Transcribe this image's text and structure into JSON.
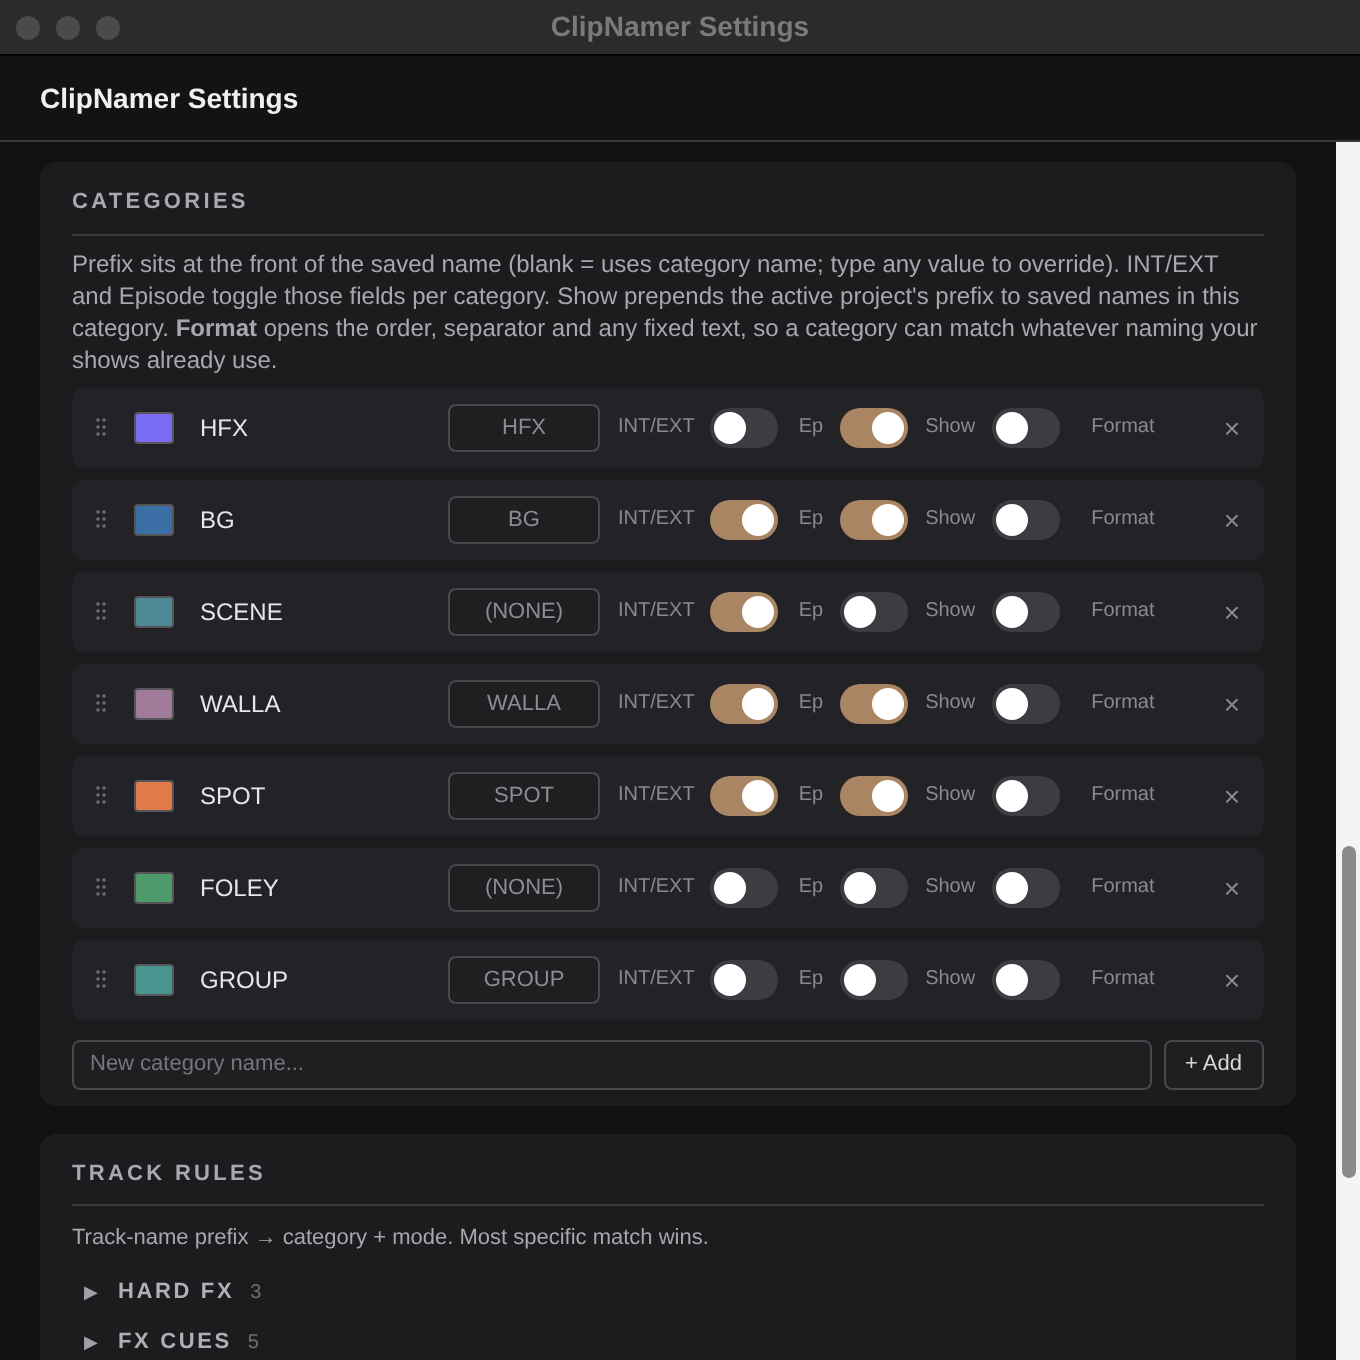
{
  "window": {
    "title": "ClipNamer Settings"
  },
  "header": {
    "title": "ClipNamer Settings"
  },
  "categories": {
    "heading": "CATEGORIES",
    "description": "Prefix sits at the front of the saved name (blank = uses category name; type any value to override). INT/EXT and Episode toggle those fields per category. Show prepends the active project's prefix to saved names in this category. **Format** opens the order, separator and any fixed text, so a category can match whatever naming your shows already use.",
    "items": [
      {
        "name": "HFX",
        "color": "#7b6cf6",
        "prefix": "HFX",
        "toggles": [
          {
            "label": "INT/EXT",
            "on": false
          },
          {
            "label": "Ep",
            "on": true
          },
          {
            "label": "Show",
            "on": false
          }
        ],
        "format": "Format",
        "remove": "×"
      },
      {
        "name": "BG",
        "color": "#3a6ea5",
        "prefix": "BG",
        "toggles": [
          {
            "label": "INT/EXT",
            "on": true
          },
          {
            "label": "Ep",
            "on": true
          },
          {
            "label": "Show",
            "on": false
          }
        ],
        "format": "Format",
        "remove": "×"
      },
      {
        "name": "SCENE",
        "color": "#4e8a96",
        "placeholder": "(NONE)",
        "toggles": [
          {
            "label": "INT/EXT",
            "on": true
          },
          {
            "label": "Ep",
            "on": false
          },
          {
            "label": "Show",
            "on": false
          }
        ],
        "format": "Format",
        "remove": "×"
      },
      {
        "name": "WALLA",
        "color": "#a07c9a",
        "prefix": "WALLA",
        "toggles": [
          {
            "label": "INT/EXT",
            "on": true
          },
          {
            "label": "Ep",
            "on": true
          },
          {
            "label": "Show",
            "on": false
          }
        ],
        "format": "Format",
        "remove": "×"
      },
      {
        "name": "SPOT",
        "color": "#e07a4a",
        "prefix": "SPOT",
        "toggles": [
          {
            "label": "INT/EXT",
            "on": true
          },
          {
            "label": "Ep",
            "on": true
          },
          {
            "label": "Show",
            "on": false
          }
        ],
        "format": "Format",
        "remove": "×"
      },
      {
        "name": "FOLEY",
        "color": "#4f9a6a",
        "placeholder": "(NONE)",
        "toggles": [
          {
            "label": "INT/EXT",
            "on": false
          },
          {
            "label": "Ep",
            "on": false
          },
          {
            "label": "Show",
            "on": false
          }
        ],
        "format": "Format",
        "remove": "×"
      },
      {
        "name": "GROUP",
        "color": "#4a9490",
        "prefix": "GROUP",
        "toggles": [
          {
            "label": "INT/EXT",
            "on": false
          },
          {
            "label": "Ep",
            "on": false
          },
          {
            "label": "Show",
            "on": false
          }
        ],
        "format": "Format",
        "remove": "×"
      }
    ],
    "new_category": {
      "placeholder": "New category name...",
      "button": "+ Add"
    }
  },
  "track_rules": {
    "heading": "TRACK RULES",
    "description": "Track-name prefix → category + mode. Most specific match wins.",
    "groups": [
      {
        "arrow": "▶",
        "name": "HARD FX",
        "count": "3",
        "expanded": false
      },
      {
        "arrow": "▶",
        "name": "FX CUES",
        "count": "5",
        "expanded": false
      }
    ]
  }
}
